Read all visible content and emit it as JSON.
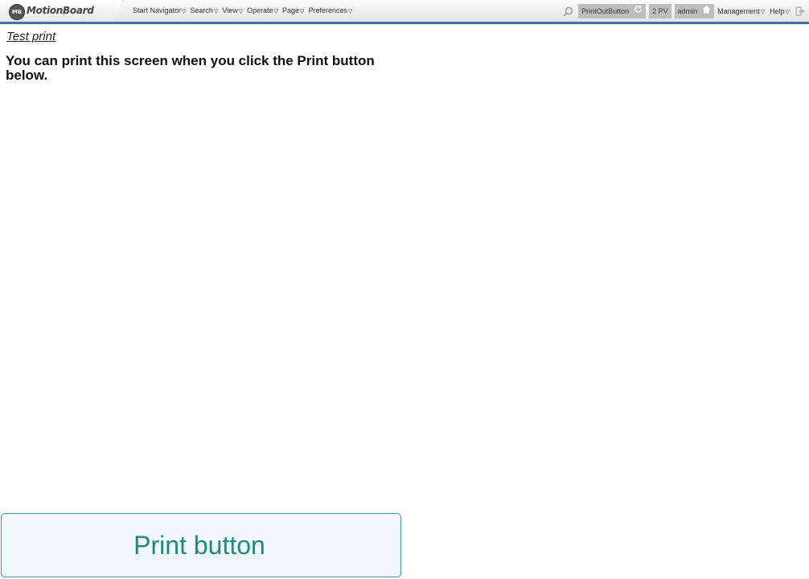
{
  "app": {
    "logo_badge": "MB",
    "logo_text": "MotionBoard"
  },
  "menu": [
    {
      "label": "Start Navigator"
    },
    {
      "label": "Search"
    },
    {
      "label": "View"
    },
    {
      "label": "Operate"
    },
    {
      "label": "Page"
    },
    {
      "label": "Preferences"
    }
  ],
  "right_bar": {
    "board_name": "PrintOutButton",
    "pv": "2 PV",
    "user": "admin",
    "management": "Management",
    "help": "Help"
  },
  "page": {
    "test_print": "Test print",
    "instruction": "You can print this screen when you click the Print button below.",
    "print_button_label": "Print button"
  },
  "colors": {
    "accent_bar": "#4a6fa5",
    "print_button_border": "#3a9a95",
    "print_button_text": "#1e8a84",
    "print_button_bg": "#f1f6fc"
  }
}
